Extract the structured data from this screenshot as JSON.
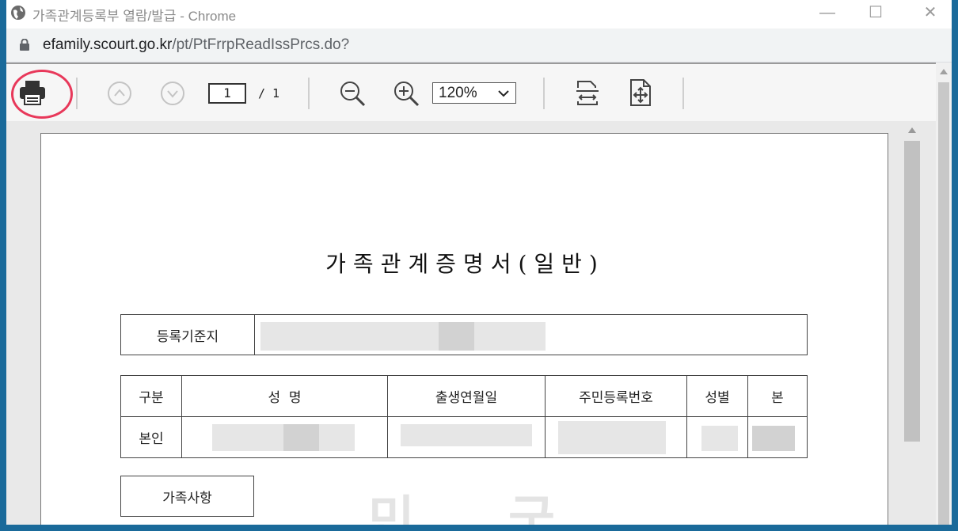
{
  "window": {
    "title": "가족관계등록부 열람/발급 - Chrome",
    "minimize_glyph": "—",
    "maximize_glyph": "☐",
    "close_glyph": "✕"
  },
  "address_bar": {
    "domain": "efamily.scourt.go.kr",
    "path": "/pt/PtFrrpReadIssPrcs.do?"
  },
  "toolbar": {
    "page_current": "1",
    "page_total": "/ 1",
    "zoom": "120%",
    "icons": [
      "print-icon",
      "previous-page-icon",
      "next-page-icon",
      "zoom-out-icon",
      "zoom-in-icon",
      "fit-width-icon",
      "fit-page-icon"
    ],
    "highlight_color": "#e8385a"
  },
  "document": {
    "title": "가족관계증명서(일반)",
    "registry_label": "등록기준지",
    "table_headers": [
      "구분",
      "성  명",
      "출생연월일",
      "주민등록번호",
      "성별",
      "본"
    ],
    "person_row_label": "본인",
    "family_section_label": "가족사항",
    "watermark_chars": [
      "민",
      "국"
    ]
  }
}
